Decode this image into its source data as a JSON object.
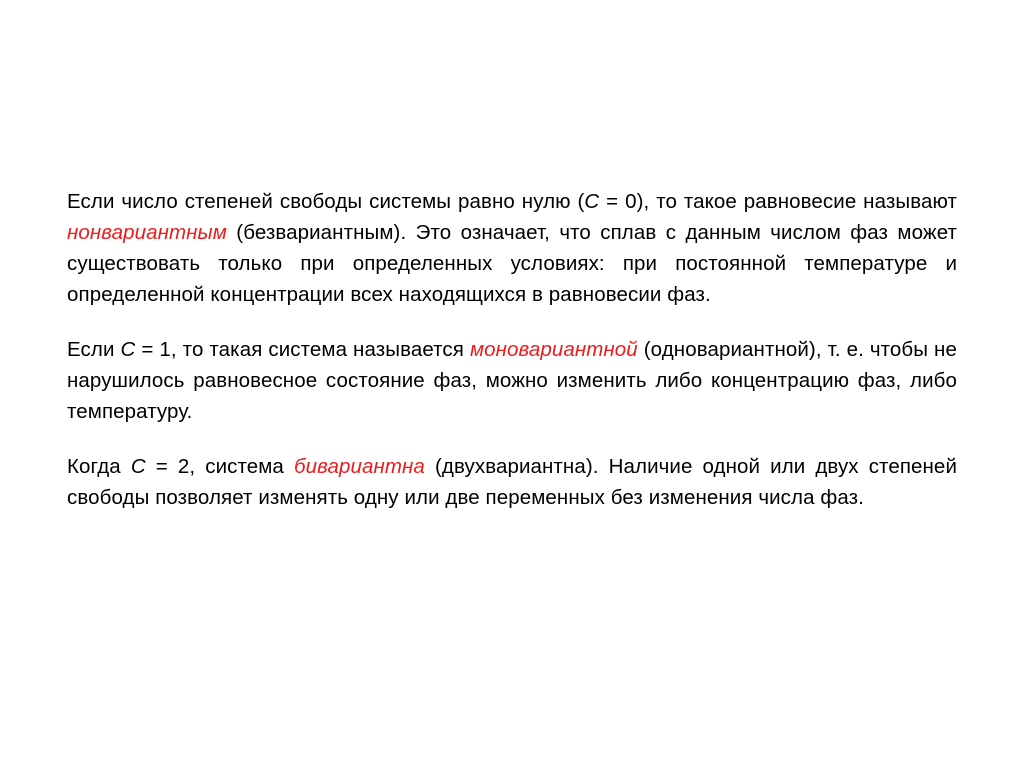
{
  "slide": {
    "background_color": "#ffffff",
    "text_color": "#000000",
    "accent_color": "#ee1b1b"
  },
  "paragraphs": [
    {
      "id": "paragraph-nonvariant",
      "segments": [
        {
          "type": "text",
          "value": "Если число степеней свободы системы равно нулю ("
        },
        {
          "type": "var",
          "value": "C"
        },
        {
          "type": "text",
          "value": " = 0), то такое равновесие называют "
        },
        {
          "type": "emred",
          "value": "нонвариантным"
        },
        {
          "type": "text",
          "value": " (безвариантным). Это означает, что сплав с данным числом фаз может существовать только при определенных условиях: при постоянной температуре и определенной концентрации всех находящихся в равновесии фаз."
        }
      ],
      "plain": "Если число степеней свободы системы равно нулю (C = 0), то такое равновесие называют нонвариантным (безвариантным). Это означает, что сплав с данным числом фаз может существовать только при определенных условиях: при постоянной температуре и определенной концентрации всех находящихся в равновесии фаз."
    },
    {
      "id": "paragraph-monovariant",
      "segments": [
        {
          "type": "text",
          "value": "Если "
        },
        {
          "type": "var",
          "value": "C"
        },
        {
          "type": "text",
          "value": " = 1, то такая система называется "
        },
        {
          "type": "emred",
          "value": "моновариантной"
        },
        {
          "type": "text",
          "value": " (одновариантной), т. е. чтобы не нарушилось равновесное состояние фаз, можно изменить либо концентрацию фаз, либо температуру."
        }
      ],
      "plain": "Если C = 1, то такая система называется моновариантной (одновариантной), т. е. чтобы не нарушилось равновесное состояние фаз, можно изменить либо концентрацию фаз, либо температуру."
    },
    {
      "id": "paragraph-bivariant",
      "segments": [
        {
          "type": "text",
          "value": "Когда "
        },
        {
          "type": "var",
          "value": "C"
        },
        {
          "type": "text",
          "value": " = 2, система "
        },
        {
          "type": "emred",
          "value": "бивариантна"
        },
        {
          "type": "text",
          "value": " (двухвариантна). Наличие одной или двух степеней свободы позволяет изменять одну или две переменных без изменения числа фаз."
        }
      ],
      "plain": "Когда C = 2, система бивариантна (двухвариантна). Наличие одной или двух степеней свободы позволяет изменять одну или две переменных без изменения числа фаз."
    }
  ]
}
